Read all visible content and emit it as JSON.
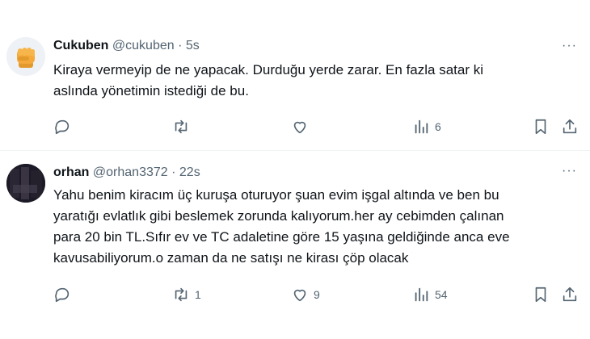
{
  "tweets": [
    {
      "name": "Cukuben",
      "handle": "@cukuben",
      "separator": "·",
      "time": "5s",
      "more": "···",
      "text_lines": [
        "Kiraya vermeyip de ne yapacak. Durduğu yerde zarar. En fazla satar ki",
        "aslında yönetimin istediği de bu."
      ],
      "avatar_icon": "fist-emoji-icon",
      "replies": "",
      "retweets": "",
      "likes": "",
      "views": "6"
    },
    {
      "name": "orhan",
      "handle": "@orhan3372",
      "separator": "·",
      "time": "22s",
      "more": "···",
      "text_lines": [
        "Yahu benim kiracım üç kuruşa oturuyor şuan evim işgal altında ve ben bu",
        "yaratığı evlatlık gibi beslemek zorunda kalıyorum.her ay cebimden çalınan",
        "para 20 bin TL.Sıfır ev ve TC adaletine göre 15 yaşına geldiğinde anca eve",
        "kavusabiliyorum.o zaman da ne satışı ne kirası çöp olacak"
      ],
      "avatar_icon": "dark-profile-photo",
      "replies": "",
      "retweets": "1",
      "likes": "9",
      "views": "54"
    }
  ],
  "icons": {
    "reply": "reply-icon",
    "retweet": "retweet-icon",
    "like": "like-icon",
    "views": "views-icon",
    "bookmark": "bookmark-icon",
    "share": "share-icon"
  },
  "colors": {
    "text": "#0f1419",
    "secondary": "#536471",
    "divider": "#eff3f4",
    "fist": "#f4a93a"
  }
}
